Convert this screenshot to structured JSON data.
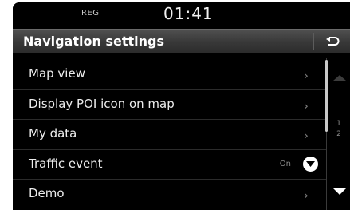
{
  "status": {
    "reg": "REG",
    "time": "01:41"
  },
  "header": {
    "title": "Navigation settings"
  },
  "menu": {
    "items": [
      {
        "label": "Map view"
      },
      {
        "label": "Display POI icon on map"
      },
      {
        "label": "My data"
      },
      {
        "label": "Traffic event",
        "value": "On"
      },
      {
        "label": "Demo"
      }
    ]
  },
  "pager": {
    "current": "1",
    "total": "2"
  },
  "icons": {
    "back": "back-arrow-icon",
    "chevron": "chevron-right-icon",
    "toggle": "dropdown-circle-icon"
  }
}
